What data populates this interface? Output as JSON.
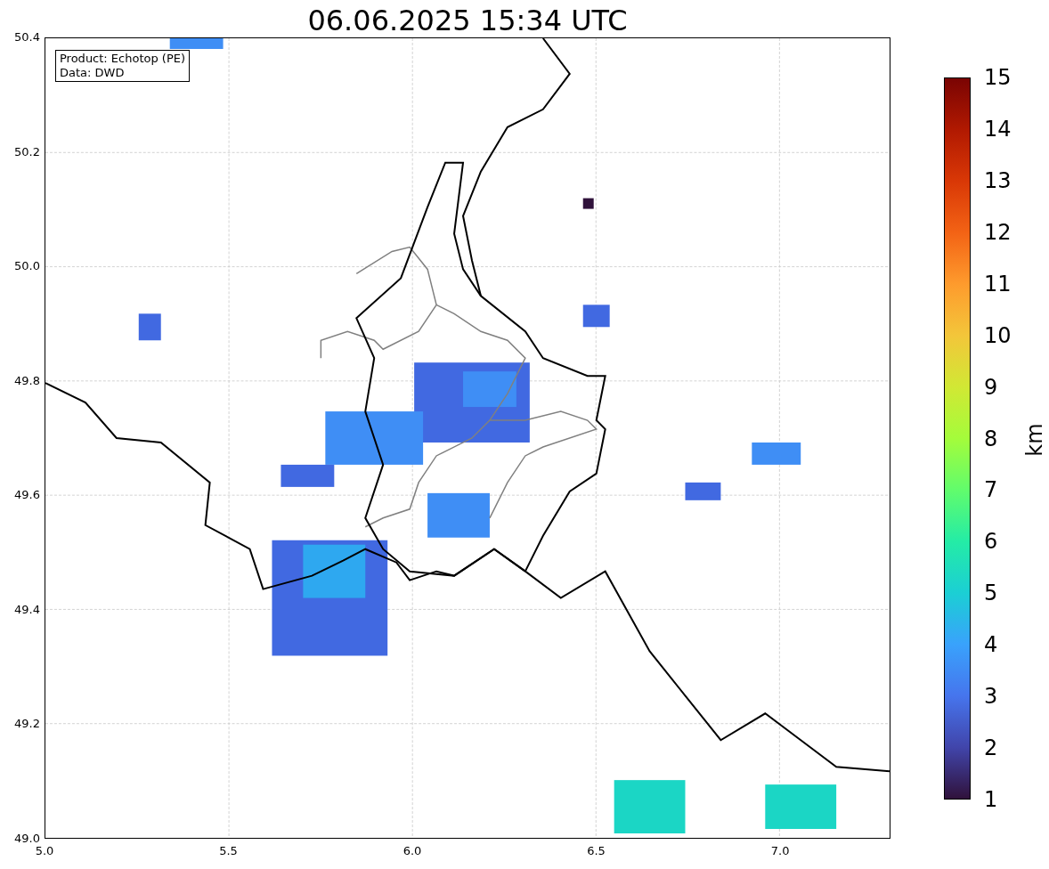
{
  "title": "06.06.2025 15:34 UTC",
  "info_box": {
    "lines": [
      "Product: Echotop (PE)",
      "Data: DWD"
    ]
  },
  "map": {
    "xticks": [
      "5.0",
      "5.5",
      "6.0",
      "6.5",
      "7.0"
    ],
    "yticks": [
      "50.4",
      "50.2",
      "50.0",
      "49.8",
      "49.6",
      "49.4",
      "49.2",
      "49.0"
    ]
  },
  "colorbar": {
    "label": "km",
    "ticks": [
      "15",
      "14",
      "13",
      "12",
      "11",
      "10",
      "9",
      "8",
      "7",
      "6",
      "5",
      "4",
      "3",
      "2",
      "1"
    ]
  }
}
